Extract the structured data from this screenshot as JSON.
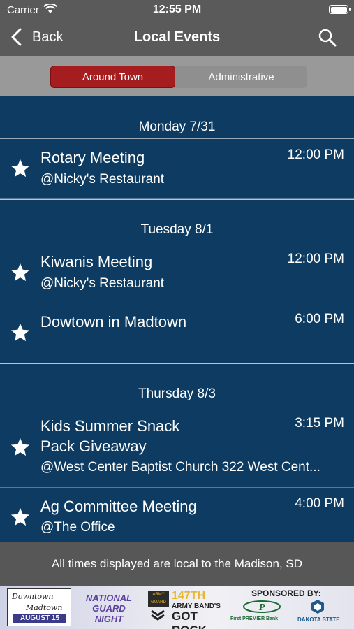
{
  "status_bar": {
    "carrier": "Carrier",
    "time": "12:55 PM"
  },
  "nav": {
    "back_label": "Back",
    "title": "Local Events"
  },
  "segments": {
    "active": "Around Town",
    "inactive": "Administrative"
  },
  "days": [
    {
      "header": "Monday 7/31",
      "events": [
        {
          "title": "Rotary Meeting",
          "time": "12:00 PM",
          "location": "@Nicky's Restaurant"
        }
      ]
    },
    {
      "header": "Tuesday 8/1",
      "events": [
        {
          "title": "Kiwanis Meeting",
          "time": "12:00 PM",
          "location": "@Nicky's Restaurant"
        },
        {
          "title": "Dowtown in Madtown",
          "time": "6:00 PM",
          "location": ""
        }
      ]
    },
    {
      "header": "Thursday 8/3",
      "events": [
        {
          "title": "Kids Summer Snack Pack Giveaway",
          "time": "3:15 PM",
          "location": "@West Center Baptist Church 322 West Cent..."
        },
        {
          "title": "Ag Committee Meeting",
          "time": "4:00 PM",
          "location": "@The Office"
        }
      ]
    }
  ],
  "footer": {
    "text": "All times displayed are local to the Madison, SD"
  },
  "banner": {
    "madtown_line1": "Downtown",
    "madtown_line2": "Madtown",
    "madtown_date": "AUGUST 15",
    "guard_line1": "NATIONAL",
    "guard_line2": "GUARD",
    "guard_line3": "NIGHT",
    "army_badge": "ARMY GUARD",
    "band_number": "147TH",
    "band_name": "ARMY BAND'S",
    "band_show": "GOT ROCK",
    "sponsored_by": "SPONSORED BY:",
    "sponsor1": "First PREMIER Bank",
    "sponsor2": "DAKOTA STATE"
  },
  "colors": {
    "background": "#0d3b61",
    "accent": "#a51d1e",
    "bar": "#5a5a5a"
  }
}
